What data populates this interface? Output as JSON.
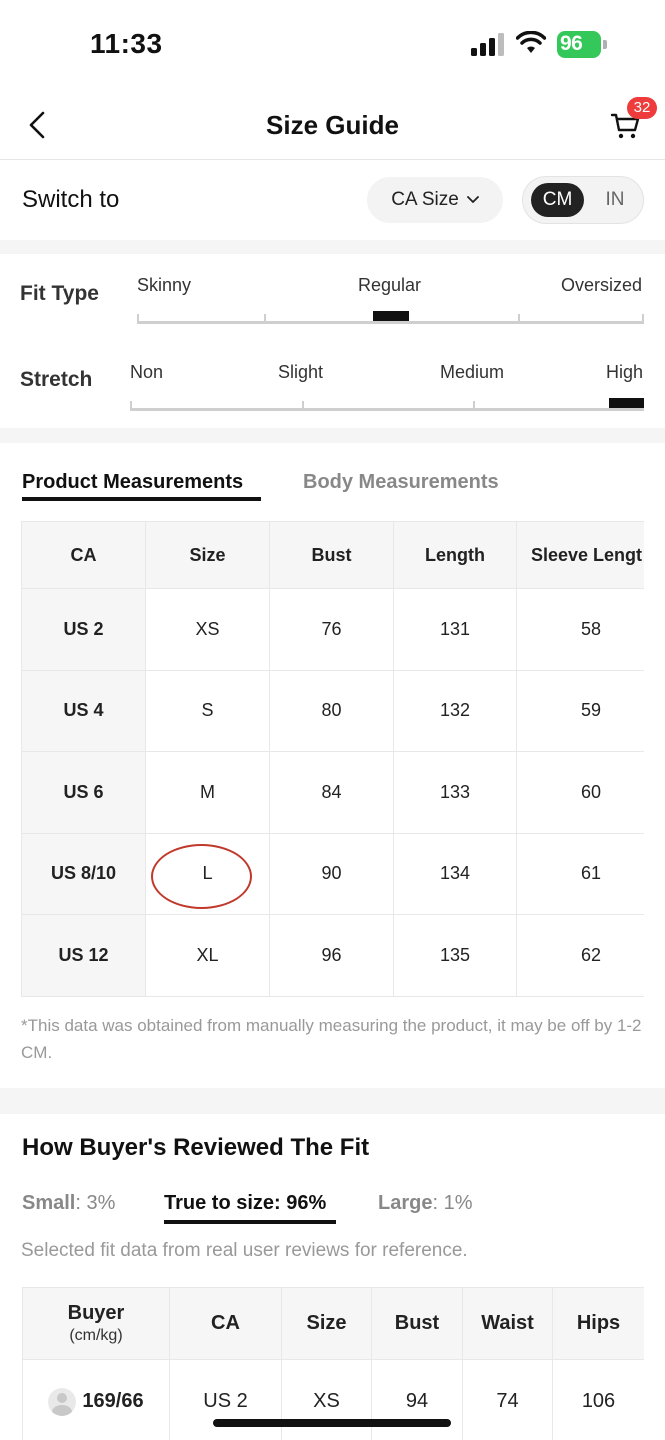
{
  "status": {
    "time": "11:33",
    "battery": "96"
  },
  "header": {
    "title": "Size Guide",
    "cart_count": "32"
  },
  "switch_row": {
    "label": "Switch to",
    "size_system": "CA Size",
    "unit_active": "CM",
    "unit_inactive": "IN"
  },
  "fit": {
    "fit_type": {
      "label": "Fit Type",
      "options": [
        "Skinny",
        "Regular",
        "Oversized"
      ],
      "selected": "Regular"
    },
    "stretch": {
      "label": "Stretch",
      "options": [
        "Non",
        "Slight",
        "Medium",
        "High"
      ],
      "selected": "High"
    }
  },
  "tabs": {
    "active": "Product Measurements",
    "inactive": "Body Measurements"
  },
  "measurements": {
    "headers": [
      "CA",
      "Size",
      "Bust",
      "Length",
      "Sleeve Lengt"
    ],
    "rows": [
      [
        "US 2",
        "XS",
        "76",
        "131",
        "58"
      ],
      [
        "US 4",
        "S",
        "80",
        "132",
        "59"
      ],
      [
        "US 6",
        "M",
        "84",
        "133",
        "60"
      ],
      [
        "US 8/10",
        "L",
        "90",
        "134",
        "61"
      ],
      [
        "US 12",
        "XL",
        "96",
        "135",
        "62"
      ]
    ],
    "highlighted_size": "L",
    "note": "*This data was obtained from manually measuring the product, it may be off by 1-2 CM."
  },
  "reviews": {
    "title": "How Buyer's Reviewed The Fit",
    "small_label": "Small",
    "small_value": ": 3%",
    "true_label": "True to size: 96%",
    "large_label": "Large",
    "large_value": ": 1%",
    "note": "Selected fit data from real user reviews for reference.",
    "headers": {
      "buyer": "Buyer",
      "buyer_sub": "(cm/kg)",
      "ca": "CA",
      "size": "Size",
      "bust": "Bust",
      "waist": "Waist",
      "hips": "Hips"
    },
    "rows": [
      {
        "buyer": "169/66",
        "ca": "US 2",
        "size": "XS",
        "bust": "94",
        "waist": "74",
        "hips": "106"
      }
    ]
  },
  "colors": {
    "accent": "#111111",
    "badge": "#ee3b3b",
    "battery": "#34c759",
    "highlight_circle": "#c0392b"
  }
}
